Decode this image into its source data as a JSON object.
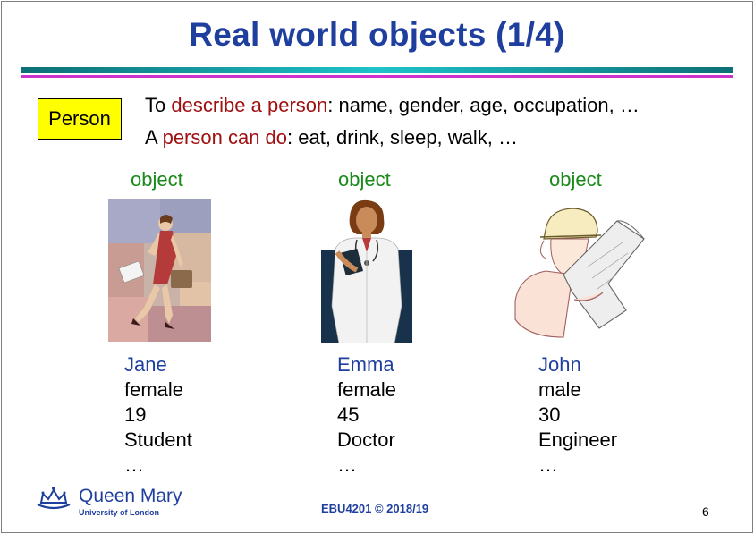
{
  "title": "Real world objects (1/4)",
  "class_box": "Person",
  "description": {
    "line1_prefix": "To ",
    "line1_highlight": "describe a person",
    "line1_rest": ": name, gender, age, occupation, …",
    "line2_prefix": "A ",
    "line2_highlight": "person can do",
    "line2_rest": ": eat, drink, sleep, walk, …"
  },
  "objects": [
    {
      "label": "object",
      "name": "Jane",
      "gender": "female",
      "age": "19",
      "occupation": "Student",
      "more": "…",
      "picture": "woman-walking-with-briefcase"
    },
    {
      "label": "object",
      "name": "Emma",
      "gender": "female",
      "age": "45",
      "occupation": "Doctor",
      "more": "…",
      "picture": "doctor-with-stethoscope"
    },
    {
      "label": "object",
      "name": "John",
      "gender": "male",
      "age": "30",
      "occupation": "Engineer",
      "more": "…",
      "picture": "engineer-reading-blueprint"
    }
  ],
  "footer": {
    "institution": "Queen Mary",
    "institution_sub": "University of London",
    "course": "EBU4201 © 2018/19",
    "page": "6"
  },
  "colors": {
    "title": "#1f3f9f",
    "highlight": "#a01010",
    "object_label": "#1a8a1a",
    "class_box": "#ffff00"
  }
}
